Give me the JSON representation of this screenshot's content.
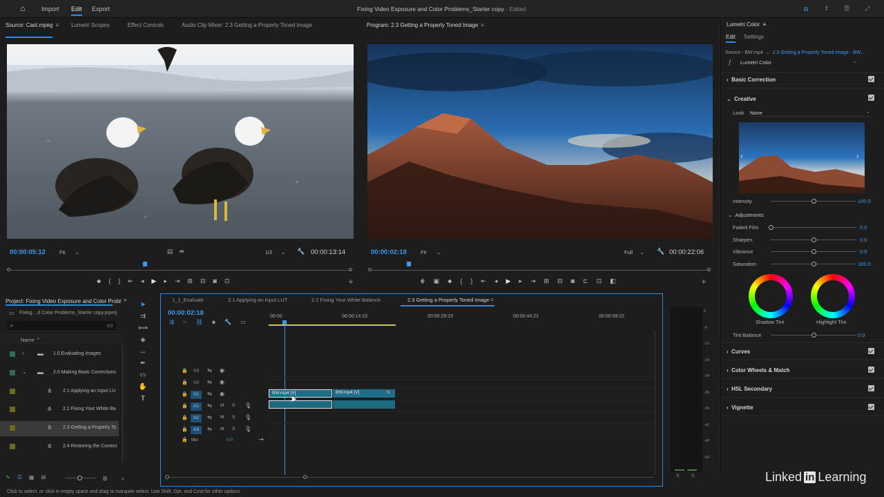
{
  "app": {
    "title": "Fixing Video Exposure and Color Problems_Starter copy",
    "title_suffix": "- Edited",
    "menu": [
      {
        "label": "Import"
      },
      {
        "label": "Edit"
      },
      {
        "label": "Export"
      }
    ]
  },
  "source": {
    "tabs": [
      "Source: Cast.mpeg",
      "Lumetri Scopes",
      "Effect Controls",
      "Audio Clip Mixer: 2.3 Getting a Properly Toned Image"
    ],
    "timecode_in": "00:00:05:12",
    "fit": "Fit",
    "resolution": "1/2",
    "timecode_out": "00:00:13:14"
  },
  "program": {
    "tab": "Program: 2.3 Getting a Properly Toned Image",
    "timecode_in": "00:00:02:18",
    "fit": "Fit",
    "resolution": "Full",
    "timecode_out": "00:00:22:06"
  },
  "project": {
    "tab": "Project: Fixing Video Exposure and Color Probl",
    "file": "Fixing ...d Color Problems_Starter copy.prproj",
    "column_name": "Name",
    "items": [
      {
        "label": "1.0 Evaluating Images",
        "type": "folder"
      },
      {
        "label": "2.0 Making Basic Corrections",
        "type": "folder"
      },
      {
        "label": "2.1 Applying an Input LU",
        "type": "sequence"
      },
      {
        "label": "2.2 Fixing Your White Ba",
        "type": "sequence"
      },
      {
        "label": "2.3 Getting a Properly To",
        "type": "sequence"
      },
      {
        "label": "2.4 Restoring the Correct",
        "type": "sequence"
      }
    ]
  },
  "timeline": {
    "tabs": [
      "1_1_Evaluate",
      "2.1 Applying an Input LUT",
      "2.2 Fixing Your White Balance",
      "2.3 Getting a Properly Toned Image"
    ],
    "timecode": "00:00:02:18",
    "ruler": [
      "00:00",
      "00:00:14:23",
      "00:00:29:23",
      "00:00:44:22",
      "00:00:59:22"
    ],
    "tracks": [
      "V3",
      "V2",
      "V1",
      "A1",
      "A2",
      "A3"
    ],
    "mix_label": "Mix",
    "mix_value": "0.0",
    "clips": [
      {
        "label": "BW.mp4 [V]"
      },
      {
        "label": "BW.mp4 [V]"
      }
    ],
    "fx": "fx"
  },
  "meter": {
    "scale": [
      "0",
      "-6",
      "-12",
      "-18",
      "-24",
      "-30",
      "-36",
      "-42",
      "-48",
      "-54"
    ],
    "solo": [
      "S",
      "S"
    ]
  },
  "lumetri": {
    "title": "Lumetri Color",
    "tabs": [
      "Edit",
      "Settings"
    ],
    "source_label": "Source - BW.mp4",
    "source_seq": "2.3 Getting a Properly Toned Image - BW...",
    "effect": "Lumetri Color",
    "basic_correction": "Basic Correction",
    "creative": "Creative",
    "look_label": "Look",
    "look_value": "None",
    "intensity_label": "Intensity",
    "intensity_value": "100.0",
    "adjustments": "Adjustments",
    "adjust": [
      {
        "label": "Faded Film",
        "value": "0.0",
        "fraction": 0.0
      },
      {
        "label": "Sharpen",
        "value": "0.0",
        "fraction": 0.5
      },
      {
        "label": "Vibrance",
        "value": "0.0",
        "fraction": 0.5
      },
      {
        "label": "Saturation",
        "value": "100.0",
        "fraction": 0.5
      }
    ],
    "intensity_fraction": 0.5,
    "shadow_tint": "Shadow Tint",
    "highlight_tint": "Highlight Tint",
    "tint_balance_label": "Tint Balance",
    "tint_balance_value": "0.0",
    "tint_balance_fraction": 0.5,
    "sections": [
      "Curves",
      "Color Wheels & Match",
      "HSL Secondary",
      "Vignette"
    ]
  },
  "status": "Click to select, or click in empty space and drag to marquee select. Use Shift, Opt, and Cmd for other options.",
  "watermark": {
    "text": "Linked",
    "box": "in",
    "text2": "Learning"
  },
  "colors": {
    "accent": "#2d8ceb",
    "timecode": "#3c9af0",
    "clip": "#1e6e8a"
  }
}
